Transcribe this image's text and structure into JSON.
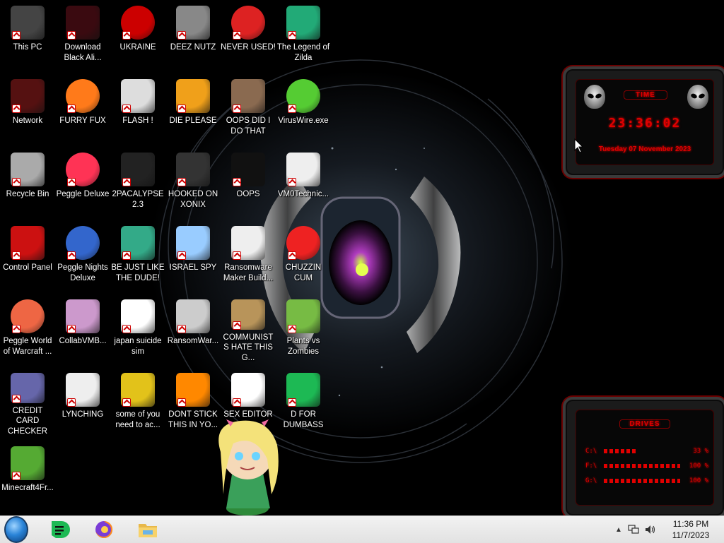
{
  "desktop": {
    "icons": [
      {
        "label": "This PC",
        "icon": "computer-icon"
      },
      {
        "label": "Download Black Ali...",
        "icon": "alienware-icon"
      },
      {
        "label": "UKRAINE",
        "icon": "radiation-icon"
      },
      {
        "label": "DEEZ NUTZ",
        "icon": "windows-stack-icon"
      },
      {
        "label": "NEVER USED!",
        "icon": "devcpp-icon"
      },
      {
        "label": "The Legend of Zilda",
        "icon": "pixel-character-icon"
      },
      {
        "label": "Network",
        "icon": "network-icon"
      },
      {
        "label": "FURRY FUX",
        "icon": "firefox-icon"
      },
      {
        "label": "FLASH !",
        "icon": "flash-icon"
      },
      {
        "label": "DIE PLEASE",
        "icon": "de-icon"
      },
      {
        "label": "OOPS DID I DO THAT",
        "icon": "portrait-icon"
      },
      {
        "label": "VirusWire.exe",
        "icon": "limewire-icon"
      },
      {
        "label": "Recycle Bin",
        "icon": "recycle-bin-icon"
      },
      {
        "label": "Peggle Deluxe",
        "icon": "peggle-icon"
      },
      {
        "label": "2PACALYPSE 2.3",
        "icon": "terminal-icon"
      },
      {
        "label": "HOOKED ON XONIX",
        "icon": "xonix-icon"
      },
      {
        "label": "OOPS",
        "icon": "ransomware-icon"
      },
      {
        "label": "VM0Technic...",
        "icon": "doctor-icon"
      },
      {
        "label": "Control Panel",
        "icon": "control-panel-icon"
      },
      {
        "label": "Peggle Nights Deluxe",
        "icon": "peggle-nights-icon"
      },
      {
        "label": "BE JUST LIKE THE DUDE!",
        "icon": "santa-icon"
      },
      {
        "label": "ISRAEL SPY",
        "icon": "network-computers-icon"
      },
      {
        "label": "Ransomware Maker Build...",
        "icon": "window-app-icon"
      },
      {
        "label": "CHUZZIN CUM",
        "icon": "chuzzle-icon"
      },
      {
        "label": "Peggle World of Warcraft ...",
        "icon": "peggle-wow-icon"
      },
      {
        "label": "CollabVMB...",
        "icon": "collabvm-icon"
      },
      {
        "label": "japan suicide sim",
        "icon": "document-icon"
      },
      {
        "label": "RansomWar...",
        "icon": "skull-icon"
      },
      {
        "label": "COMMUNISTS HATE THIS G...",
        "icon": "money-bag-icon"
      },
      {
        "label": "Plants vs Zombies",
        "icon": "plants-icon"
      },
      {
        "label": "CREDIT CARD CHECKER",
        "icon": "credit-card-icon"
      },
      {
        "label": "LYNCHING",
        "icon": "lynching-icon"
      },
      {
        "label": "some of you need to ac...",
        "icon": "cartoon-dog-icon"
      },
      {
        "label": "DONT STICK THIS IN YO...",
        "icon": "vlc-icon"
      },
      {
        "label": "SEX EDITOR",
        "icon": "hxd-icon"
      },
      {
        "label": "D FOR DUMBASS",
        "icon": "d-app-icon"
      },
      {
        "label": "Minecraft4Fr...",
        "icon": "minecraft-icon"
      }
    ]
  },
  "clock_widget": {
    "title": "TIME",
    "time": "23:36:02",
    "date": "Tuesday 07 November 2023"
  },
  "drives_widget": {
    "title": "DRIVES",
    "drives": [
      {
        "letter": "C:\\",
        "percent": 33,
        "label": "33 %"
      },
      {
        "letter": "F:\\",
        "percent": 100,
        "label": "100 %"
      },
      {
        "letter": "G:\\",
        "percent": 100,
        "label": "100 %"
      }
    ]
  },
  "taskbar": {
    "time": "11:36 PM",
    "date": "11/7/2023",
    "pinned": [
      "d-app-icon",
      "firefox-icon",
      "file-explorer-icon"
    ]
  },
  "colors": {
    "widget_red": "#e00000",
    "taskbar_bg": "#ececec"
  }
}
